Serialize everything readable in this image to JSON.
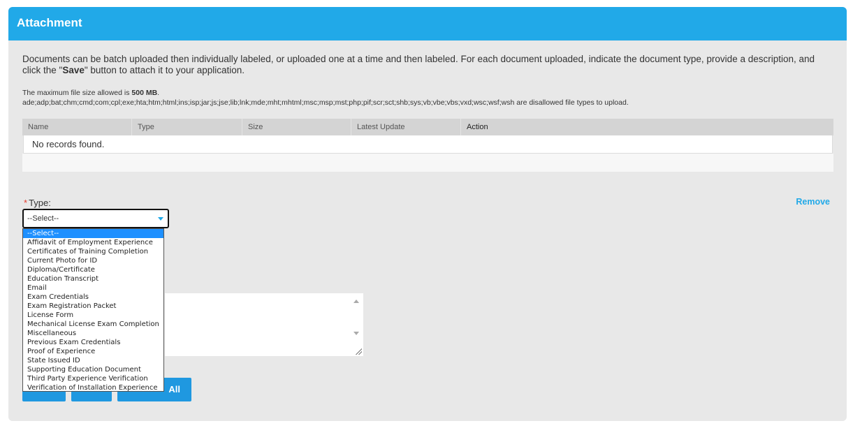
{
  "panel": {
    "title": "Attachment"
  },
  "intro": {
    "text_before": "Documents can be batch uploaded then individually labeled, or uploaded one at a time and then labeled. For each document uploaded, indicate the document type, provide a description, and click the \"",
    "bold": "Save",
    "text_after": "\" button to attach it to your application."
  },
  "limits": {
    "max_size_prefix": "The maximum file size allowed is ",
    "max_size_value": "500 MB",
    "max_size_suffix": ".",
    "disallowed": "ade;adp;bat;chm;cmd;com;cpl;exe;hta;htm;html;ins;isp;jar;js;jse;lib;lnk;mde;mht;mhtml;msc;msp;mst;php;pif;scr;sct;shb;sys;vb;vbe;vbs;vxd;wsc;wsf;wsh are disallowed file types to upload."
  },
  "table": {
    "columns": [
      "Name",
      "Type",
      "Size",
      "Latest Update",
      "Action"
    ],
    "empty_message": "No records found."
  },
  "form": {
    "required_mark": "*",
    "type_label": "Type:",
    "type_selected": "--Select--",
    "remove_label": "Remove",
    "button3_visible_label": "All"
  },
  "dropdown_options": [
    "--Select--",
    "Affidavit of Employment Experience",
    "Certificates of Training Completion",
    "Current Photo for ID",
    "Diploma/Certificate",
    "Education Transcript",
    "Email",
    "Exam Credentials",
    "Exam Registration Packet",
    "License Form",
    "Mechanical License Exam Completion",
    "Miscellaneous",
    "Previous Exam Credentials",
    "Proof of Experience",
    "State Issued ID",
    "Supporting Education Document",
    "Third Party Experience Verification",
    "Verification of Installation Experience"
  ],
  "colors": {
    "accent": "#21a9e8",
    "button": "#1f98e0",
    "panel_bg": "#e8e8e8",
    "required": "#e53b2c",
    "selected_option": "#1e90ff"
  },
  "icons": {
    "select_arrow": "chevron-down-icon",
    "resize": "resize-grip-icon"
  }
}
